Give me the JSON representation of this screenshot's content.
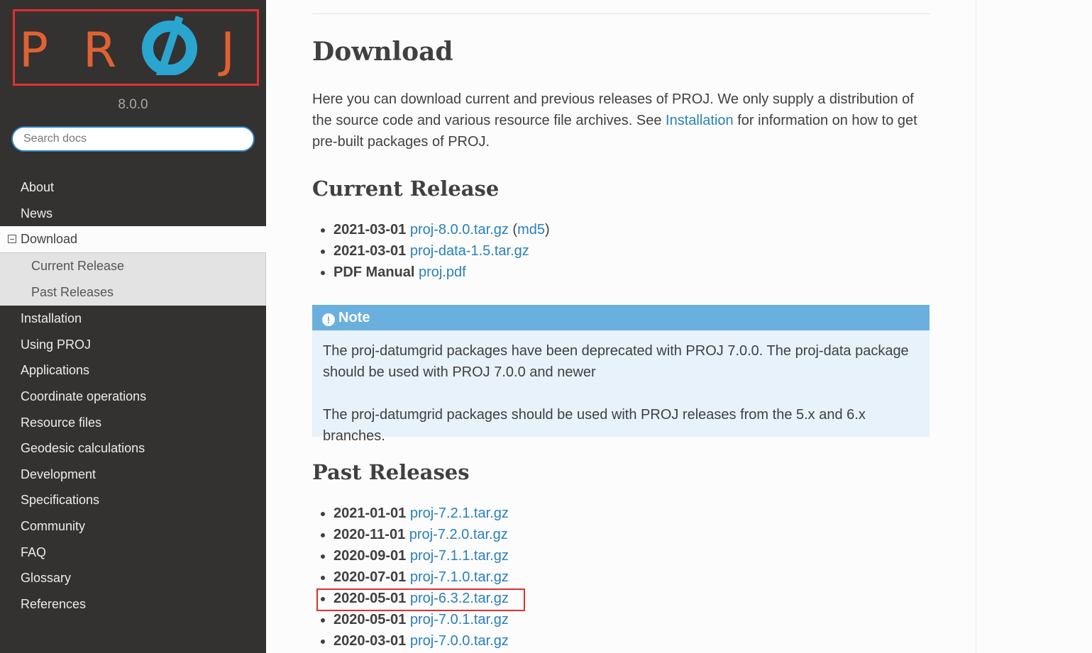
{
  "sidebar": {
    "logo_letters": [
      "P",
      "R",
      "J"
    ],
    "version": "8.0.0",
    "search_placeholder": "Search docs",
    "nav": [
      {
        "label": "About"
      },
      {
        "label": "News"
      },
      {
        "label": "Download"
      },
      {
        "label": "Current Release"
      },
      {
        "label": "Past Releases"
      },
      {
        "label": "Installation"
      },
      {
        "label": "Using PROJ"
      },
      {
        "label": "Applications"
      },
      {
        "label": "Coordinate operations"
      },
      {
        "label": "Resource files"
      },
      {
        "label": "Geodesic calculations"
      },
      {
        "label": "Development"
      },
      {
        "label": "Specifications"
      },
      {
        "label": "Community"
      },
      {
        "label": "FAQ"
      },
      {
        "label": "Glossary"
      },
      {
        "label": "References"
      }
    ]
  },
  "main": {
    "title": "Download",
    "intro_part1": "Here you can download current and previous releases of PROJ. We only supply a distribution of the source code and various resource file archives. See ",
    "intro_link": "Installation",
    "intro_part2": " for information on how to get pre-built packages of PROJ.",
    "current_heading": "Current Release",
    "current": [
      {
        "date": "2021-03-01",
        "link": "proj-8.0.0.tar.gz",
        "extra_open": " (",
        "extra_link": "md5",
        "extra_close": ")"
      },
      {
        "date": "2021-03-01",
        "link": "proj-data-1.5.tar.gz"
      },
      {
        "date": "PDF Manual",
        "link": "proj.pdf"
      }
    ],
    "note": {
      "title": "Note",
      "p1": "The proj-datumgrid packages have been deprecated with PROJ 7.0.0. The proj-data package should be used with PROJ 7.0.0 and newer",
      "p2": "The proj-datumgrid packages should be used with PROJ releases from the 5.x and 6.x branches."
    },
    "past_heading": "Past Releases",
    "past": [
      {
        "date": "2021-01-01",
        "link": "proj-7.2.1.tar.gz"
      },
      {
        "date": "2020-11-01",
        "link": "proj-7.2.0.tar.gz"
      },
      {
        "date": "2020-09-01",
        "link": "proj-7.1.1.tar.gz"
      },
      {
        "date": "2020-07-01",
        "link": "proj-7.1.0.tar.gz"
      },
      {
        "date": "2020-05-01",
        "link": "proj-6.3.2.tar.gz"
      },
      {
        "date": "2020-05-01",
        "link": "proj-7.0.1.tar.gz"
      },
      {
        "date": "2020-03-01",
        "link": "proj-7.0.0.tar.gz"
      }
    ]
  },
  "colors": {
    "sidebar_bg": "#343131",
    "link": "#2980b9",
    "note_header": "#6ab0de",
    "note_bg": "#e7f2fa",
    "logo_orange": "#e06232",
    "logo_blue": "#2aa5cf",
    "highlight_red": "#e03030"
  }
}
